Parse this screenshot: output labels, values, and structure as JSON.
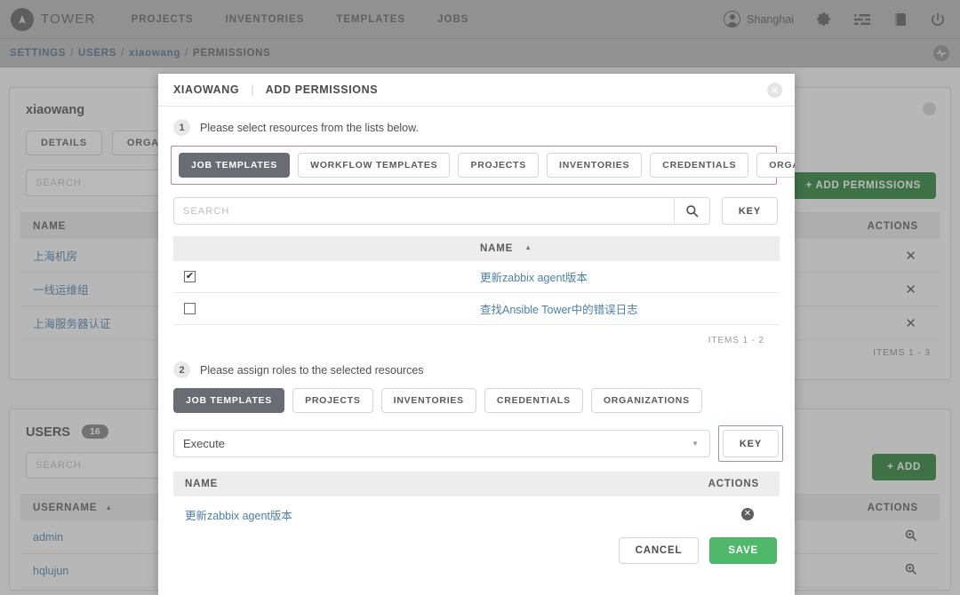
{
  "topnav": {
    "brand": "TOWER",
    "links": [
      "PROJECTS",
      "INVENTORIES",
      "TEMPLATES",
      "JOBS"
    ],
    "user": "Shanghai",
    "icons": [
      "gear-icon",
      "list-icon",
      "book-icon",
      "power-icon"
    ]
  },
  "breadcrumb": {
    "settings": "SETTINGS",
    "users": "USERS",
    "user": "xiaowang",
    "current": "PERMISSIONS",
    "sep": "/"
  },
  "background": {
    "permissions_panel": {
      "title": "xiaowang",
      "tabs": [
        "DETAILS",
        "ORGANIZATIONS"
      ],
      "search_placeholder": "SEARCH",
      "add_button": "+ ADD PERMISSIONS",
      "col_name": "NAME",
      "col_actions": "ACTIONS",
      "rows": [
        {
          "name": "上海机房",
          "action": "✕"
        },
        {
          "name": "一线运维组",
          "action": "✕"
        },
        {
          "name": "上海服务器认证",
          "action": "✕"
        }
      ],
      "items_note": "ITEMS 1 - 3"
    },
    "users_panel": {
      "title": "USERS",
      "count": "16",
      "search_placeholder": "SEARCH",
      "add_button": "+ ADD",
      "col_username": "USERNAME",
      "col_actions": "ACTIONS",
      "rows": [
        {
          "username": "admin"
        },
        {
          "username": "hqlujun"
        }
      ]
    }
  },
  "modal": {
    "title_user": "XIAOWANG",
    "title_sep": "|",
    "title_action": "ADD PERMISSIONS",
    "close_icon": "✕",
    "step1": {
      "num": "1",
      "text": "Please select resources from the lists below.",
      "tabs": [
        {
          "label": "JOB TEMPLATES",
          "active": true
        },
        {
          "label": "WORKFLOW TEMPLATES",
          "active": false
        },
        {
          "label": "PROJECTS",
          "active": false
        },
        {
          "label": "INVENTORIES",
          "active": false
        },
        {
          "label": "CREDENTIALS",
          "active": false
        },
        {
          "label": "ORGANIZATIONS",
          "active": false
        }
      ],
      "search_placeholder": "SEARCH",
      "search_value": "",
      "key_button": "KEY",
      "col_name": "NAME",
      "sort_caret": "▲",
      "rows": [
        {
          "name": "更新zabbix agent版本",
          "checked": true
        },
        {
          "name": "查找Ansible Tower中的错误日志",
          "checked": false
        }
      ],
      "items_note": "ITEMS 1 - 2"
    },
    "step2": {
      "num": "2",
      "text": "Please assign roles to the selected resources",
      "tabs": [
        {
          "label": "JOB TEMPLATES",
          "active": true
        },
        {
          "label": "PROJECTS",
          "active": false
        },
        {
          "label": "INVENTORIES",
          "active": false
        },
        {
          "label": "CREDENTIALS",
          "active": false
        },
        {
          "label": "ORGANIZATIONS",
          "active": false
        }
      ],
      "role_value": "Execute",
      "role_caret": "▼",
      "key_button": "KEY",
      "col_name": "NAME",
      "col_actions": "ACTIONS",
      "selected": [
        {
          "name": "更新zabbix agent版本",
          "remove": "✕"
        }
      ]
    },
    "footer": {
      "cancel": "CANCEL",
      "save": "SAVE"
    }
  },
  "colors": {
    "nav_bg": "#b7b7b7",
    "highlight_border": "#b38a90",
    "accent_green": "#4fb86a",
    "bg_green": "#207c2e",
    "link_blue": "#4a7fa8",
    "active_tab": "#6b6b73"
  }
}
